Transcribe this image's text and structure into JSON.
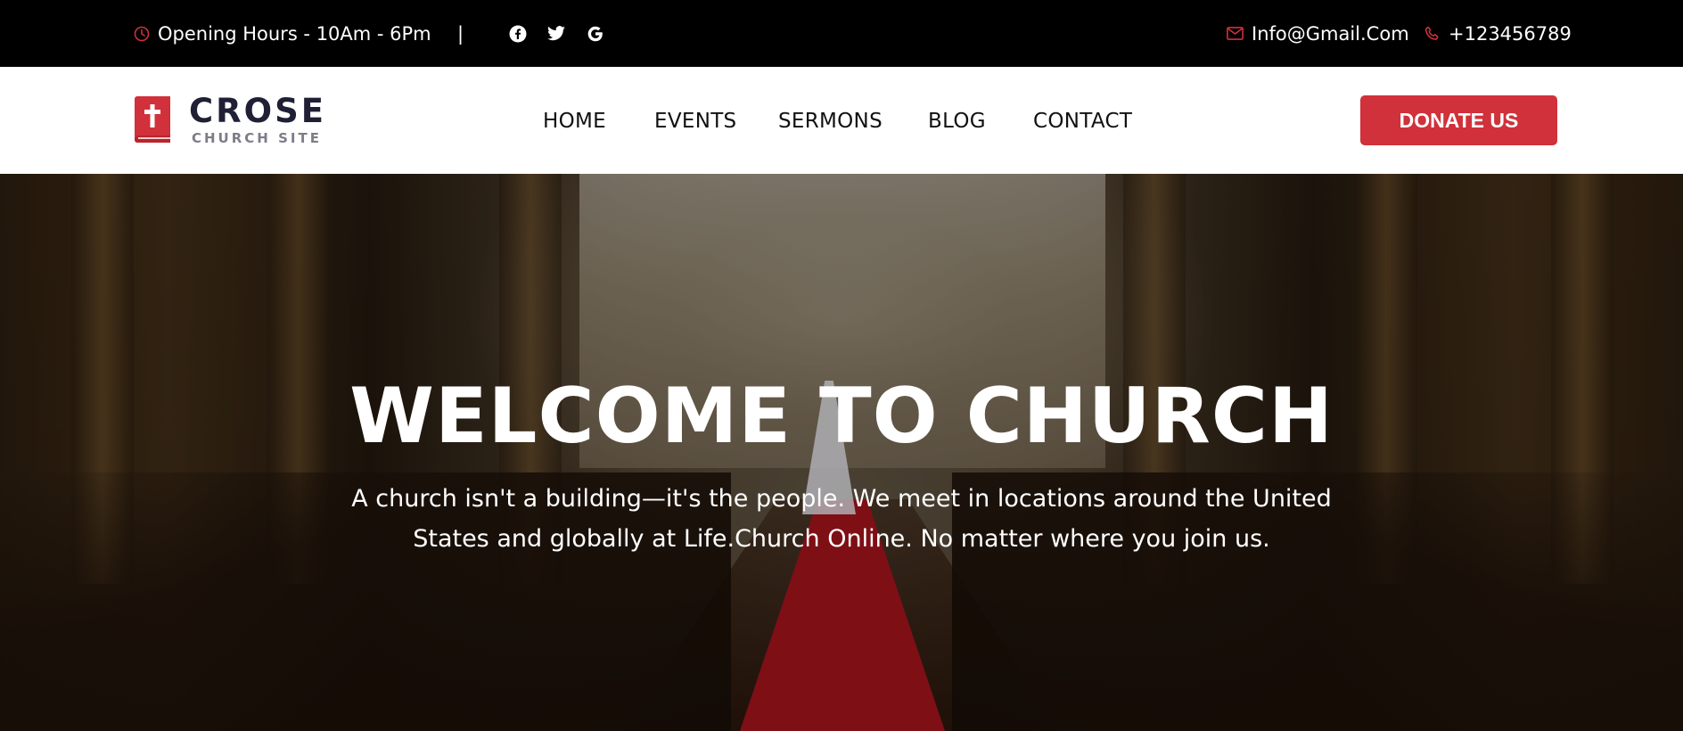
{
  "topbar": {
    "hours": "Opening Hours - 10Am - 6Pm",
    "divider": "|",
    "social": [
      "facebook-icon",
      "twitter-icon",
      "google-icon"
    ],
    "email": "Info@Gmail.Com",
    "phone": "+123456789",
    "accent_color": "#d0313a"
  },
  "brand": {
    "name": "CROSE",
    "tagline": "CHURCH SITE",
    "color": "#d0313a"
  },
  "nav": {
    "items": [
      "HOME",
      "EVENTS",
      "SERMONS",
      "BLOG",
      "CONTACT"
    ]
  },
  "cta": {
    "donate_label": "DONATE US",
    "color": "#d0313a"
  },
  "hero": {
    "title": "WELCOME TO CHURCH",
    "text": "A church isn't a building—it's the people. We meet in locations around the United States and globally at Life.Church Online. No matter where you join us."
  }
}
